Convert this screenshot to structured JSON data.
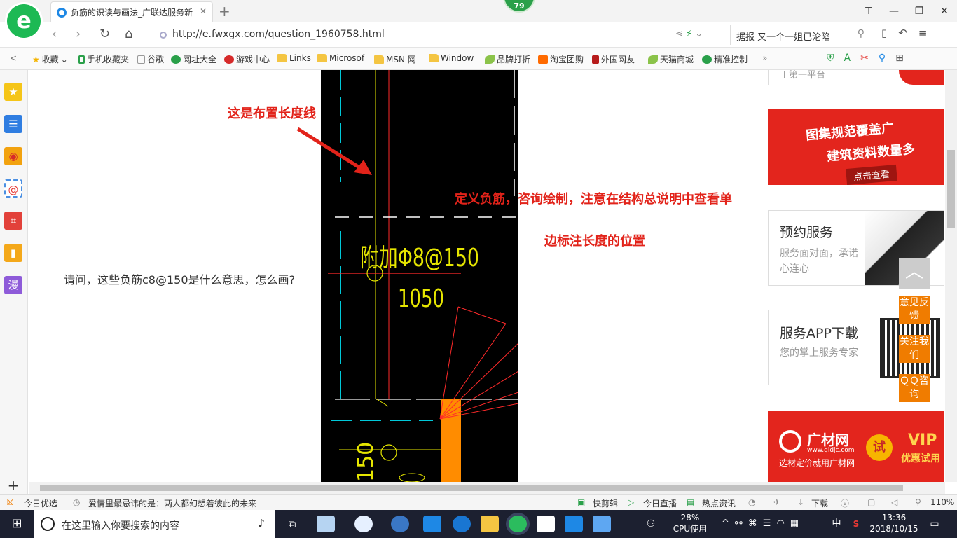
{
  "browser": {
    "tab_title": "负筋的识读与画法_广联达服务新",
    "tab_close": "✕",
    "new_tab": "+",
    "notification_count": "79",
    "window_controls": [
      "⊤",
      "—",
      "❐",
      "✕"
    ],
    "url": "http://e.fwxgx.com/question_1960758.html",
    "search_text": "据报 又一个一姐已沦陷"
  },
  "bookmarks": {
    "collapse": "<",
    "items": [
      {
        "label": "收藏",
        "icon": "star-icon"
      },
      {
        "label": "手机收藏夹",
        "icon": "phone-icon"
      },
      {
        "label": "谷歌",
        "icon": "page-icon"
      },
      {
        "label": "网址大全",
        "icon": "globe-icon"
      },
      {
        "label": "游戏中心",
        "icon": "game-icon"
      },
      {
        "label": "Links",
        "icon": "folder-icon"
      },
      {
        "label": "Microsof",
        "icon": "folder-icon"
      },
      {
        "label": "MSN 网",
        "icon": "folder-icon"
      },
      {
        "label": "Window",
        "icon": "folder-icon"
      },
      {
        "label": "品牌打折",
        "icon": "leaf-icon"
      },
      {
        "label": "淘宝团购",
        "icon": "taobao-icon"
      },
      {
        "label": "外国网友",
        "icon": "bookmark-icon"
      },
      {
        "label": "天猫商城",
        "icon": "leaf-icon"
      },
      {
        "label": "精准控制",
        "icon": "chat-icon"
      }
    ],
    "more": "»"
  },
  "sidebar": {
    "manga_label": "漫",
    "add": "+"
  },
  "content": {
    "question": "请问，这些负筋c8@150是什么意思，怎么画?",
    "annotation_arrow": "这是布置长度线",
    "annotation_line1": "定义负筋，咨询绘制，注意在结构总说明中查看单",
    "annotation_line2": "边标注长度的位置",
    "cad_text1": "附加Φ8@150",
    "cad_text2": "1050",
    "cad_text3": "150",
    "top_card_text": "于第一平台"
  },
  "ads": {
    "banner1_line1": "图集规范覆盖广",
    "banner1_line2": "建筑资料数量多",
    "banner1_button": "点击查看",
    "banner2_brand": "广材网",
    "banner2_site": "www.gldjc.com",
    "banner2_tagline": "选材定价就用广材网",
    "banner2_try": "试",
    "banner2_vip": "VIP",
    "banner2_offer": "优惠试用"
  },
  "cards": {
    "booking_title": "预约服务",
    "booking_sub": "服务面对面，承诺心连心",
    "app_title": "服务APP下载",
    "app_sub": "您的掌上服务专家"
  },
  "float": {
    "to_top": "︿",
    "feedback": "意见反馈",
    "follow": "关注我们",
    "qq": "ＱＱ咨询"
  },
  "statusbar": {
    "today_pick": "今日优选",
    "news": "爱情里最忌讳的是：两人都幻想着彼此的未来",
    "quick_clip": "快剪辑",
    "live": "今日直播",
    "hot_news": "热点资讯",
    "download": "下载",
    "zoom": "110%"
  },
  "taskbar": {
    "search_placeholder": "在这里输入你要搜索的内容",
    "cpu_percent": "28%",
    "cpu_label": "CPU使用",
    "ime": "中",
    "time": "13:36",
    "date": "2018/10/15"
  },
  "colors": {
    "cad_red": "#ff2a2a",
    "cad_yellow": "#e6e600",
    "cad_cyan": "#00c8d8",
    "annotation_red": "#e2231a",
    "float_orange": "#f07c00",
    "taskbar_bg": "#1c2030"
  }
}
